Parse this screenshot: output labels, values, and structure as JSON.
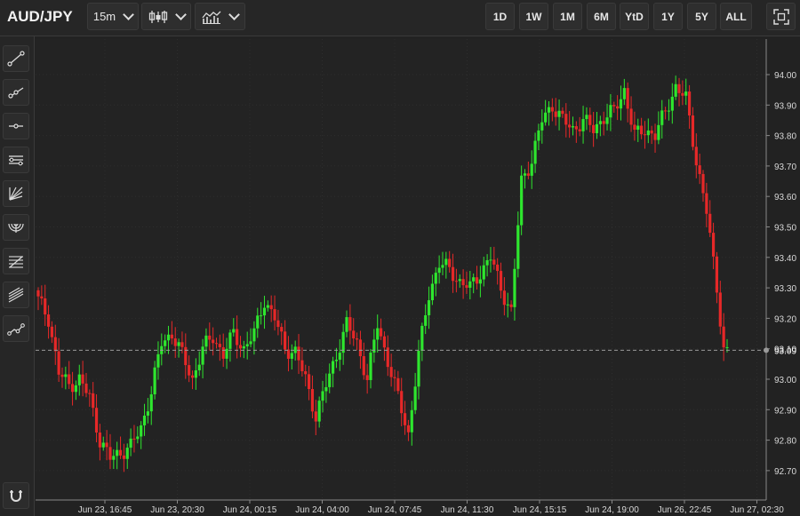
{
  "header": {
    "symbol": "AUD/JPY",
    "interval": "15m",
    "chart_type_icon": "candlestick-icon",
    "indicators_icon": "indicators-icon",
    "ranges": [
      "1D",
      "1W",
      "1M",
      "6M",
      "YtD",
      "1Y",
      "5Y",
      "ALL"
    ],
    "fullscreen_icon": "fullscreen-icon"
  },
  "sidebar": {
    "tools": [
      "trend-line-icon",
      "ray-line-icon",
      "horizontal-line-icon",
      "parallel-channel-icon",
      "fan-icon",
      "arc-icon",
      "fib-retracement-icon",
      "pitchfork-icon",
      "multi-line-icon"
    ],
    "bottom_tool": "magnet-icon"
  },
  "chart_data": {
    "type": "candlestick",
    "xlabel": "",
    "ylabel": "",
    "ylim": [
      92.62,
      94.08
    ],
    "y_ticks": [
      "94.00",
      "93.90",
      "93.80",
      "93.70",
      "93.60",
      "93.50",
      "93.40",
      "93.30",
      "93.20",
      "93.10",
      "93.00",
      "92.90",
      "92.80",
      "92.70"
    ],
    "x_ticks": [
      "Jun 23, 16:45",
      "Jun 23, 20:30",
      "Jun 24, 00:15",
      "Jun 24, 04:00",
      "Jun 24, 07:45",
      "Jun 24, 11:30",
      "Jun 24, 15:15",
      "Jun 24, 19:00",
      "Jun 26, 22:45",
      "Jun 27, 02:30"
    ],
    "last_price_label": "93.09",
    "last_price": 93.095,
    "grid": true,
    "up_color": "#2ee62e",
    "down_color": "#e62828",
    "close_path": [
      [
        0,
        93.26
      ],
      [
        3,
        93.2
      ],
      [
        6,
        93.02
      ],
      [
        9,
        92.98
      ],
      [
        12,
        93.0
      ],
      [
        15,
        92.94
      ],
      [
        18,
        92.8
      ],
      [
        21,
        92.74
      ],
      [
        24,
        92.76
      ],
      [
        27,
        92.78
      ],
      [
        30,
        92.84
      ],
      [
        33,
        92.96
      ],
      [
        36,
        93.12
      ],
      [
        39,
        93.15
      ],
      [
        42,
        93.08
      ],
      [
        45,
        93.0
      ],
      [
        48,
        93.1
      ],
      [
        51,
        93.14
      ],
      [
        54,
        93.08
      ],
      [
        57,
        93.15
      ],
      [
        60,
        93.1
      ],
      [
        63,
        93.15
      ],
      [
        66,
        93.26
      ],
      [
        69,
        93.2
      ],
      [
        72,
        93.1
      ],
      [
        75,
        93.09
      ],
      [
        78,
        93.0
      ],
      [
        81,
        92.88
      ],
      [
        84,
        92.98
      ],
      [
        87,
        93.08
      ],
      [
        90,
        93.18
      ],
      [
        93,
        93.12
      ],
      [
        96,
        93.0
      ],
      [
        99,
        93.18
      ],
      [
        102,
        93.06
      ],
      [
        105,
        92.94
      ],
      [
        108,
        92.82
      ],
      [
        111,
        93.08
      ],
      [
        114,
        93.28
      ],
      [
        117,
        93.38
      ],
      [
        120,
        93.36
      ],
      [
        123,
        93.32
      ],
      [
        126,
        93.3
      ],
      [
        129,
        93.35
      ],
      [
        132,
        93.4
      ],
      [
        135,
        93.3
      ],
      [
        138,
        93.22
      ],
      [
        141,
        93.65
      ],
      [
        144,
        93.72
      ],
      [
        147,
        93.85
      ],
      [
        150,
        93.9
      ],
      [
        153,
        93.85
      ],
      [
        156,
        93.82
      ],
      [
        159,
        93.85
      ],
      [
        162,
        93.82
      ],
      [
        165,
        93.86
      ],
      [
        168,
        93.88
      ],
      [
        171,
        93.95
      ],
      [
        174,
        93.8
      ],
      [
        177,
        93.82
      ],
      [
        180,
        93.8
      ],
      [
        183,
        93.88
      ],
      [
        186,
        93.96
      ],
      [
        189,
        93.92
      ],
      [
        192,
        93.72
      ],
      [
        195,
        93.55
      ],
      [
        198,
        93.3
      ],
      [
        200,
        93.1
      ],
      [
        201,
        93.09
      ]
    ]
  }
}
